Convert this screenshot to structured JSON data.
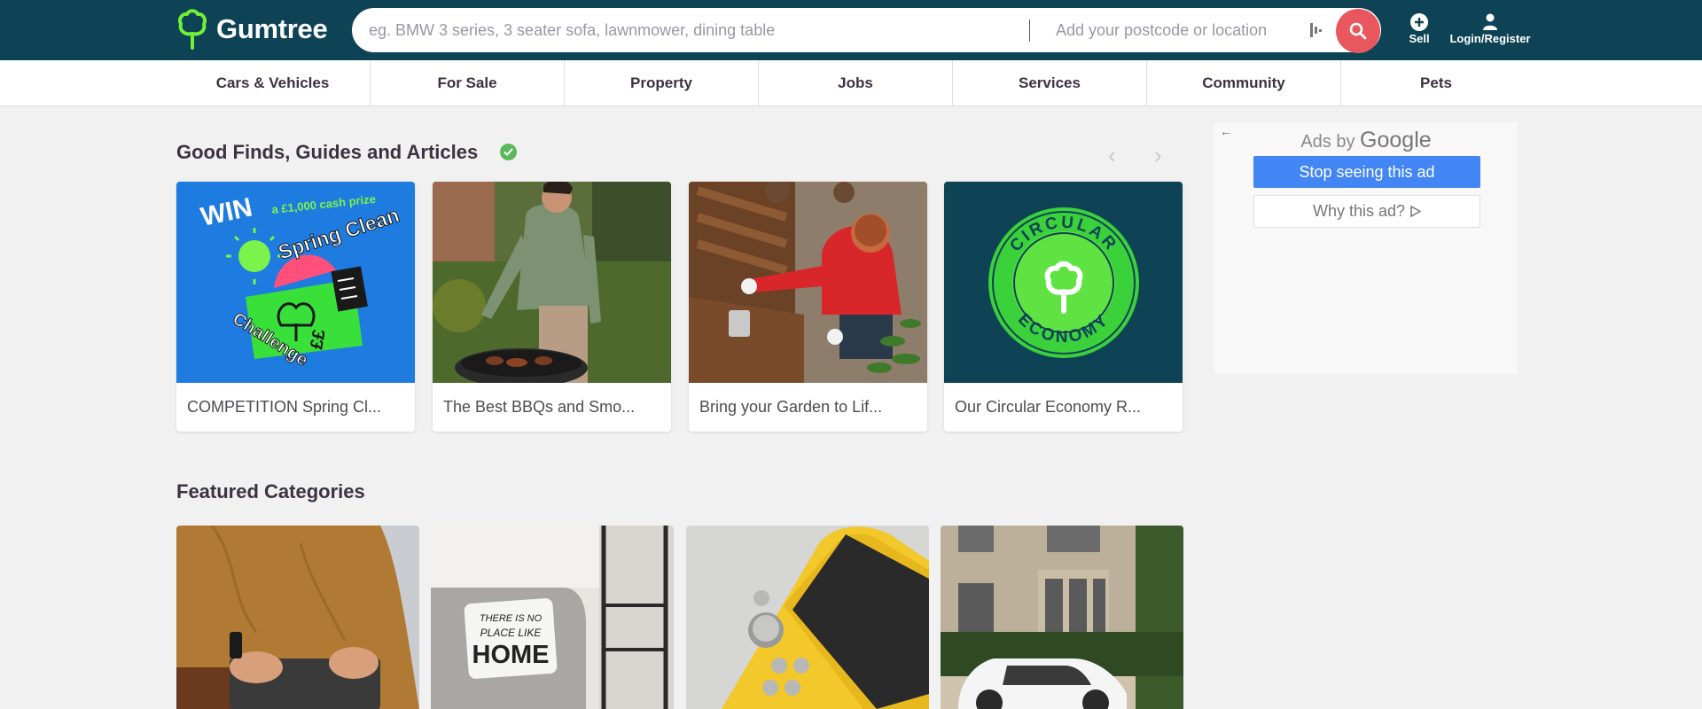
{
  "header": {
    "logo_text": "Gumtree",
    "search_placeholder": "eg. BMW 3 series, 3 seater sofa, lawnmower, dining table",
    "location_placeholder": "Add your postcode or location",
    "sell_label": "Sell",
    "login_label": "Login/Register"
  },
  "nav": {
    "items": [
      {
        "label": "Cars & Vehicles"
      },
      {
        "label": "For Sale"
      },
      {
        "label": "Property"
      },
      {
        "label": "Jobs"
      },
      {
        "label": "Services"
      },
      {
        "label": "Community"
      },
      {
        "label": "Pets"
      }
    ]
  },
  "articles": {
    "title": "Good Finds, Guides and Articles",
    "cards": [
      {
        "caption": "COMPETITION Spring Cl...",
        "art_text": [
          "WIN",
          "a £1,000 cash prize",
          "Spring Clean",
          "Challenge",
          "££"
        ]
      },
      {
        "caption": "The Best BBQs and Smo..."
      },
      {
        "caption": "Bring your Garden to Lif..."
      },
      {
        "caption": "Our Circular Economy R...",
        "art_text": [
          "CIRCULAR",
          "ECONOMY"
        ]
      }
    ]
  },
  "featured": {
    "title": "Featured Categories",
    "cards": [
      {
        "art_text": []
      },
      {
        "art_text": [
          "THERE IS NO",
          "PLACE LIKE",
          "HOME"
        ]
      },
      {
        "art_text": []
      },
      {
        "art_text": []
      }
    ]
  },
  "ad": {
    "ads_by": "Ads by",
    "google": "Google",
    "stop_label": "Stop seeing this ad",
    "why_label": "Why this ad?"
  },
  "colors": {
    "header_bg": "#0e4355",
    "brand_green": "#72ef36",
    "search_button": "#e8575e",
    "ad_button": "#4285f4"
  }
}
